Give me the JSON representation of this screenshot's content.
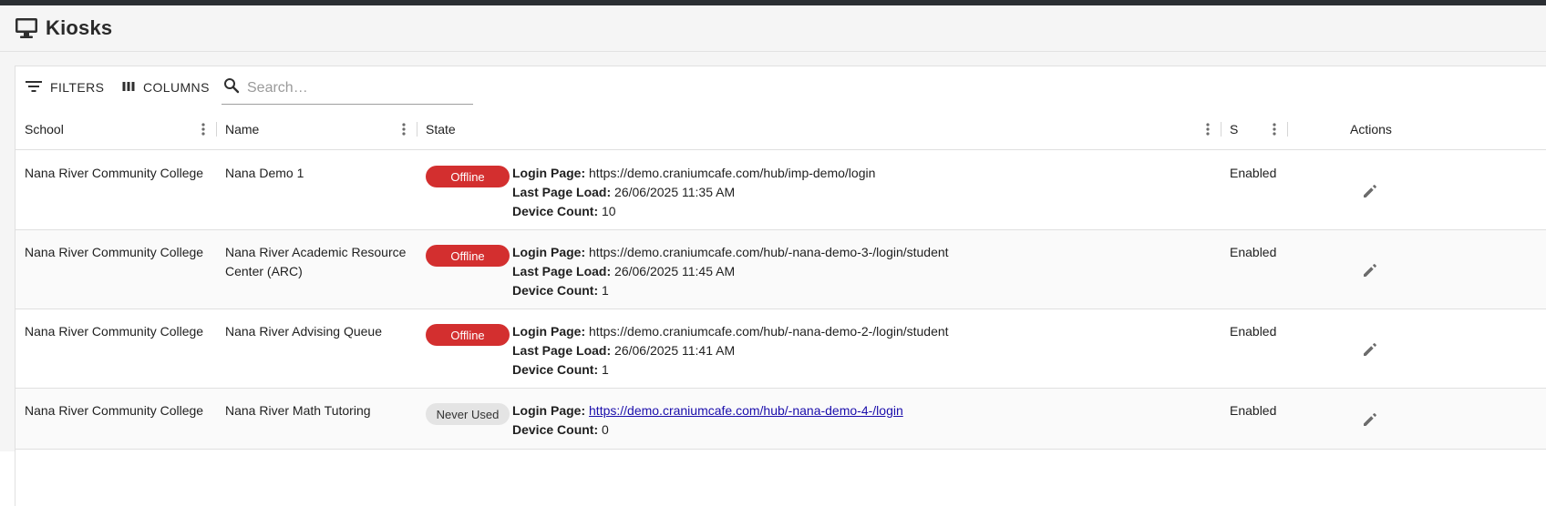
{
  "page": {
    "title": "Kiosks"
  },
  "toolbar": {
    "filters_label": "FILTERS",
    "columns_label": "COLUMNS",
    "search_placeholder": "Search…",
    "search_value": ""
  },
  "columns": {
    "school": "School",
    "name": "Name",
    "state": "State",
    "status_short": "S",
    "actions": "Actions"
  },
  "labels": {
    "login_page": "Login Page:",
    "last_page_load": "Last Page Load:",
    "device_count": "Device Count:"
  },
  "rows": [
    {
      "school": "Nana River Community College",
      "name": "Nana Demo 1",
      "state": "Offline",
      "login_page": "https://demo.craniumcafe.com/hub/imp-demo/login",
      "last_page_load": "26/06/2025 11:35 AM",
      "device_count": "10",
      "status": "Enabled"
    },
    {
      "school": "Nana River Community College",
      "name": "Nana River Academic Resource Center (ARC)",
      "state": "Offline",
      "login_page": "https://demo.craniumcafe.com/hub/-nana-demo-3-/login/student",
      "last_page_load": "26/06/2025 11:45 AM",
      "device_count": "1",
      "status": "Enabled"
    },
    {
      "school": "Nana River Community College",
      "name": "Nana River Advising Queue",
      "state": "Offline",
      "login_page": "https://demo.craniumcafe.com/hub/-nana-demo-2-/login/student",
      "last_page_load": "26/06/2025 11:41 AM",
      "device_count": "1",
      "status": "Enabled"
    },
    {
      "school": "Nana River Community College",
      "name": "Nana River Math Tutoring",
      "state": "Never Used",
      "login_page": "https://demo.craniumcafe.com/hub/-nana-demo-4-/login",
      "device_count": "0",
      "status": "Enabled"
    }
  ],
  "colors": {
    "offline": "#d32f2f",
    "never_used": "#e4e4e4",
    "link": "#1a0dab",
    "icon": "#6b6b6b"
  },
  "icons": {
    "header": "desktop-monitor-icon",
    "filters": "filter-list-icon",
    "columns": "view-column-icon",
    "search": "search-icon",
    "column_menu": "more-vert-icon",
    "edit": "pencil-icon"
  }
}
